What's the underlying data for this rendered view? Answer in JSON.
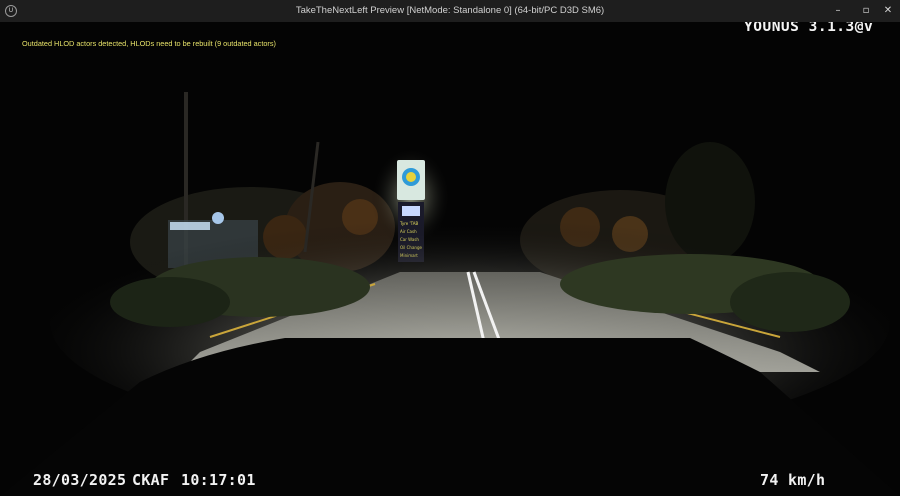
{
  "window": {
    "title": "TakeTheNextLeft Preview [NetMode: Standalone 0]  (64-bit/PC D3D SM6)",
    "logo_text": "U",
    "controls": {
      "minimize": "–",
      "maximize": "▫",
      "close": "✕"
    }
  },
  "hud": {
    "watermark": "YOUNUS 3.1.3@v",
    "warning": "Outdated HLOD actors detected, HLODs need to be rebuilt (9 outdated actors)",
    "date": "28/03/2025",
    "code": "CKAF",
    "time": "10:17:01",
    "speed": "74 km/h"
  },
  "scene": {
    "sign_entries": [
      "Tyre 'TAB",
      "Air Cash",
      "Car Wash",
      "Oil Change",
      "Minimart"
    ]
  },
  "colors": {
    "warning": "#e8e36a",
    "hud_text": "#f2f2f2",
    "titlebar_bg": "#1e1e1e",
    "road_line": "#ffffff",
    "road_edge_line": "#c9a53a"
  }
}
